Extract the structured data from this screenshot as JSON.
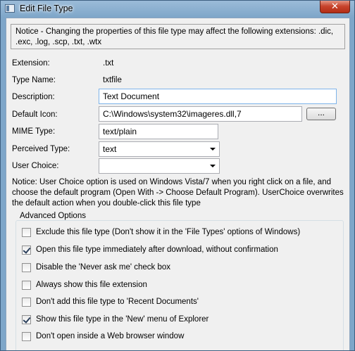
{
  "window": {
    "title": "Edit File Type",
    "close_glyph": "✕"
  },
  "notice": "Notice - Changing the properties of this file type may affect the following extensions: .dic, .exc, .log, .scp, .txt, .wtx",
  "fields": {
    "extension": {
      "label": "Extension:",
      "value": ".txt"
    },
    "type_name": {
      "label": "Type Name:",
      "value": "txtfile"
    },
    "description": {
      "label": "Description:",
      "value": "Text Document"
    },
    "default_icon": {
      "label": "Default Icon:",
      "value": "C:\\Windows\\system32\\imageres.dll,7",
      "browse_label": "..."
    },
    "mime_type": {
      "label": "MIME Type:",
      "value": "text/plain"
    },
    "perceived_type": {
      "label": "Perceived Type:",
      "value": "text"
    },
    "user_choice": {
      "label": "User Choice:",
      "value": ""
    }
  },
  "user_choice_notice": "Notice: User Choice option is used on Windows Vista/7 when you right click on a file, and choose the default program (Open With -> Choose Default Program). UserChoice overwrites the default action when you double-click this file type",
  "advanced": {
    "title": "Advanced Options",
    "options": [
      {
        "label": "Exclude  this file type (Don't show it in the 'File Types' options of Windows)",
        "checked": false
      },
      {
        "label": "Open this file type immediately after download, without confirmation",
        "checked": true
      },
      {
        "label": "Disable the 'Never ask me' check box",
        "checked": false
      },
      {
        "label": "Always show this file extension",
        "checked": false
      },
      {
        "label": "Don't add this file type to 'Recent Documents'",
        "checked": false
      },
      {
        "label": "Show this file type in the 'New' menu of Explorer",
        "checked": true
      },
      {
        "label": "Don't open inside a Web browser window",
        "checked": false
      }
    ]
  }
}
